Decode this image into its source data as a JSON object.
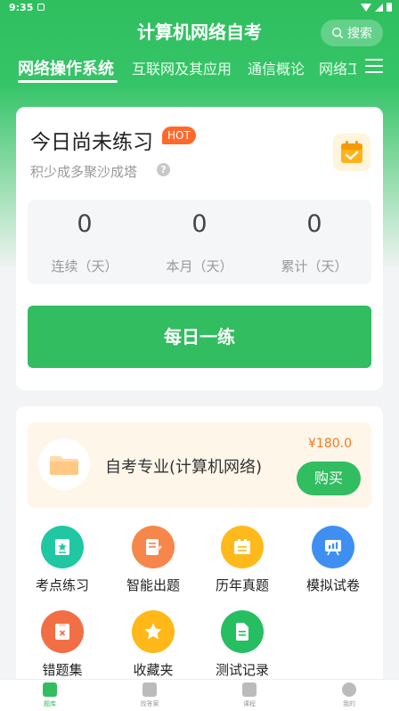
{
  "status_bar": {
    "time": "9:35"
  },
  "header": {
    "title": "计算机网络自考",
    "search_label": "搜索"
  },
  "tabs": [
    {
      "label": "网络操作系统",
      "active": true
    },
    {
      "label": "互联网及其应用",
      "active": false
    },
    {
      "label": "通信概论",
      "active": false
    },
    {
      "label": "网络工",
      "active": false
    }
  ],
  "practice_card": {
    "title": "今日尚未练习",
    "badge": "HOT",
    "subtitle": "积少成多聚沙成塔",
    "help": "?",
    "stats": [
      {
        "value": "0",
        "label": "连续（天）"
      },
      {
        "value": "0",
        "label": "本月（天）"
      },
      {
        "value": "0",
        "label": "累计（天）"
      }
    ],
    "daily_button": "每日一练"
  },
  "product": {
    "name": "自考专业(计算机网络)",
    "price": "¥180.0",
    "buy_label": "购买"
  },
  "features": [
    {
      "label": "考点练习",
      "icon": "star-card-icon",
      "color": "#1fc7a3"
    },
    {
      "label": "智能出题",
      "icon": "document-edit-icon",
      "color": "#f7864a"
    },
    {
      "label": "历年真题",
      "icon": "file-box-icon",
      "color": "#ffb91a"
    },
    {
      "label": "模拟试卷",
      "icon": "chart-board-icon",
      "color": "#3f8ff2"
    },
    {
      "label": "错题集",
      "icon": "wrong-note-icon",
      "color": "#f26f45"
    },
    {
      "label": "收藏夹",
      "icon": "star-icon",
      "color": "#ffb818"
    },
    {
      "label": "测试记录",
      "icon": "record-icon",
      "color": "#25be61"
    }
  ],
  "bottom_nav": [
    {
      "label": "题库",
      "active": true,
      "color": "#31bd60"
    },
    {
      "label": "找答案",
      "active": false,
      "color": "#bbbbbb"
    },
    {
      "label": "课程",
      "active": false,
      "color": "#bbbbbb"
    },
    {
      "label": "我的",
      "active": false,
      "color": "#bbbbbb"
    }
  ]
}
